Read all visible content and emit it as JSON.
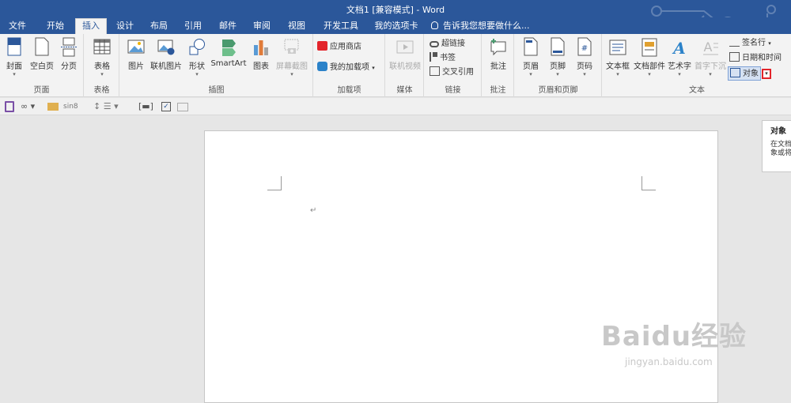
{
  "window": {
    "title": "文档1 [兼容模式] - Word"
  },
  "tabs": [
    {
      "label": "文件"
    },
    {
      "label": "开始"
    },
    {
      "label": "插入"
    },
    {
      "label": "设计"
    },
    {
      "label": "布局"
    },
    {
      "label": "引用"
    },
    {
      "label": "邮件"
    },
    {
      "label": "审阅"
    },
    {
      "label": "视图"
    },
    {
      "label": "开发工具"
    },
    {
      "label": "我的选项卡"
    }
  ],
  "active_tab": "插入",
  "tell_me": {
    "placeholder": "告诉我您想要做什么..."
  },
  "ribbon": {
    "pages": {
      "label": "页面",
      "cover": "封面",
      "blank": "空白页",
      "break": "分页"
    },
    "tables": {
      "label": "表格",
      "table": "表格"
    },
    "illustrations": {
      "label": "插图",
      "picture": "图片",
      "online_picture": "联机图片",
      "shapes": "形状",
      "smartart": "SmartArt",
      "chart": "图表",
      "screenshot": "屏幕截图"
    },
    "addins": {
      "label": "加载项",
      "store": "应用商店",
      "my_addins": "我的加载项"
    },
    "media": {
      "label": "媒体",
      "online_video": "联机视频"
    },
    "links": {
      "label": "链接",
      "hyperlink": "超链接",
      "bookmark": "书签",
      "cross_ref": "交叉引用"
    },
    "comments": {
      "label": "批注",
      "comment": "批注"
    },
    "header_footer": {
      "label": "页眉和页脚",
      "header": "页眉",
      "footer": "页脚",
      "page_number": "页码"
    },
    "text": {
      "label": "文本",
      "textbox": "文本框",
      "quick_parts": "文档部件",
      "wordart": "艺术字",
      "dropcap": "首字下沉",
      "signature": "签名行",
      "datetime": "日期和时间",
      "object": "对象"
    }
  },
  "qat": {
    "font_size": "sin8"
  },
  "document": {
    "paragraph_mark": "↵"
  },
  "tooltip": {
    "title": "对象",
    "body": "在文档中插入对象或将文本。"
  },
  "watermark": {
    "main": "Baidu经验",
    "sub": "jingyan.baidu.com"
  },
  "colors": {
    "brand": "#2b579a",
    "highlight": "#e3242b"
  }
}
